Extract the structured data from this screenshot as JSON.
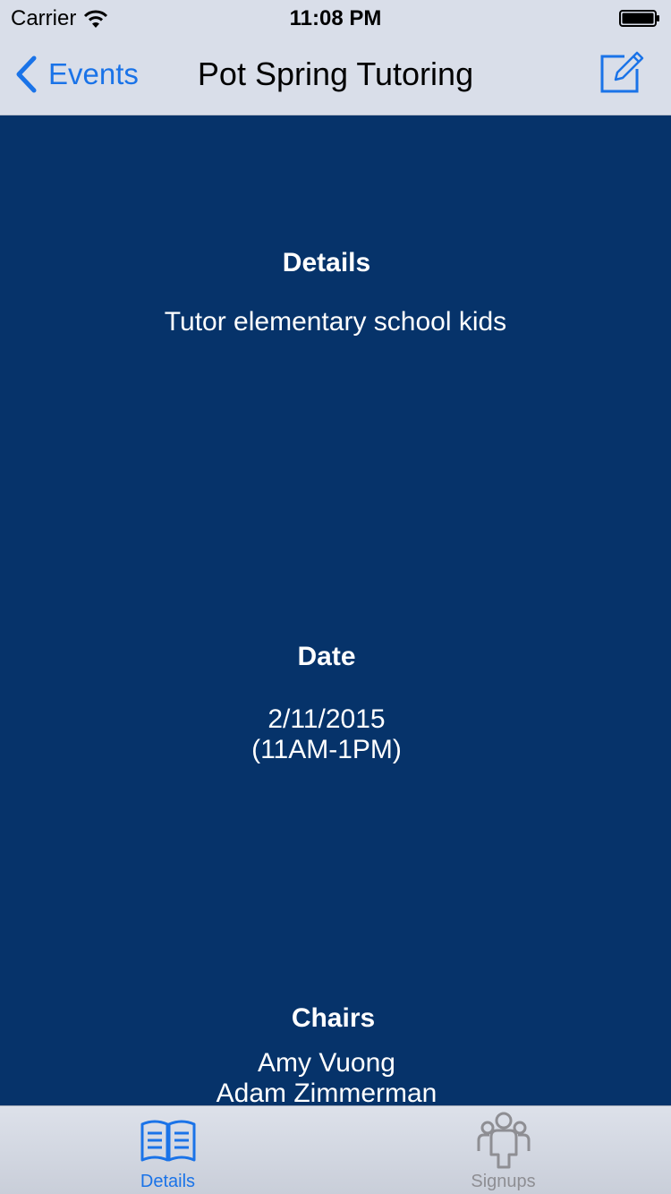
{
  "status_bar": {
    "carrier": "Carrier",
    "time": "11:08 PM"
  },
  "nav": {
    "back_label": "Events",
    "title": "Pot Spring Tutoring"
  },
  "sections": {
    "details": {
      "heading": "Details",
      "body": "Tutor elementary school kids"
    },
    "date": {
      "heading": "Date",
      "line1": "2/11/2015",
      "line2": "(11AM-1PM)"
    },
    "chairs": {
      "heading": "Chairs",
      "names": [
        "Amy Vuong",
        "Adam Zimmerman"
      ]
    }
  },
  "tabs": [
    {
      "label": "Details",
      "selected": true
    },
    {
      "label": "Signups",
      "selected": false
    }
  ],
  "colors": {
    "accent": "#1a73e8",
    "content_background": "#06336a",
    "header_background": "#d9dee9",
    "tab_inactive": "#8e8e93"
  }
}
